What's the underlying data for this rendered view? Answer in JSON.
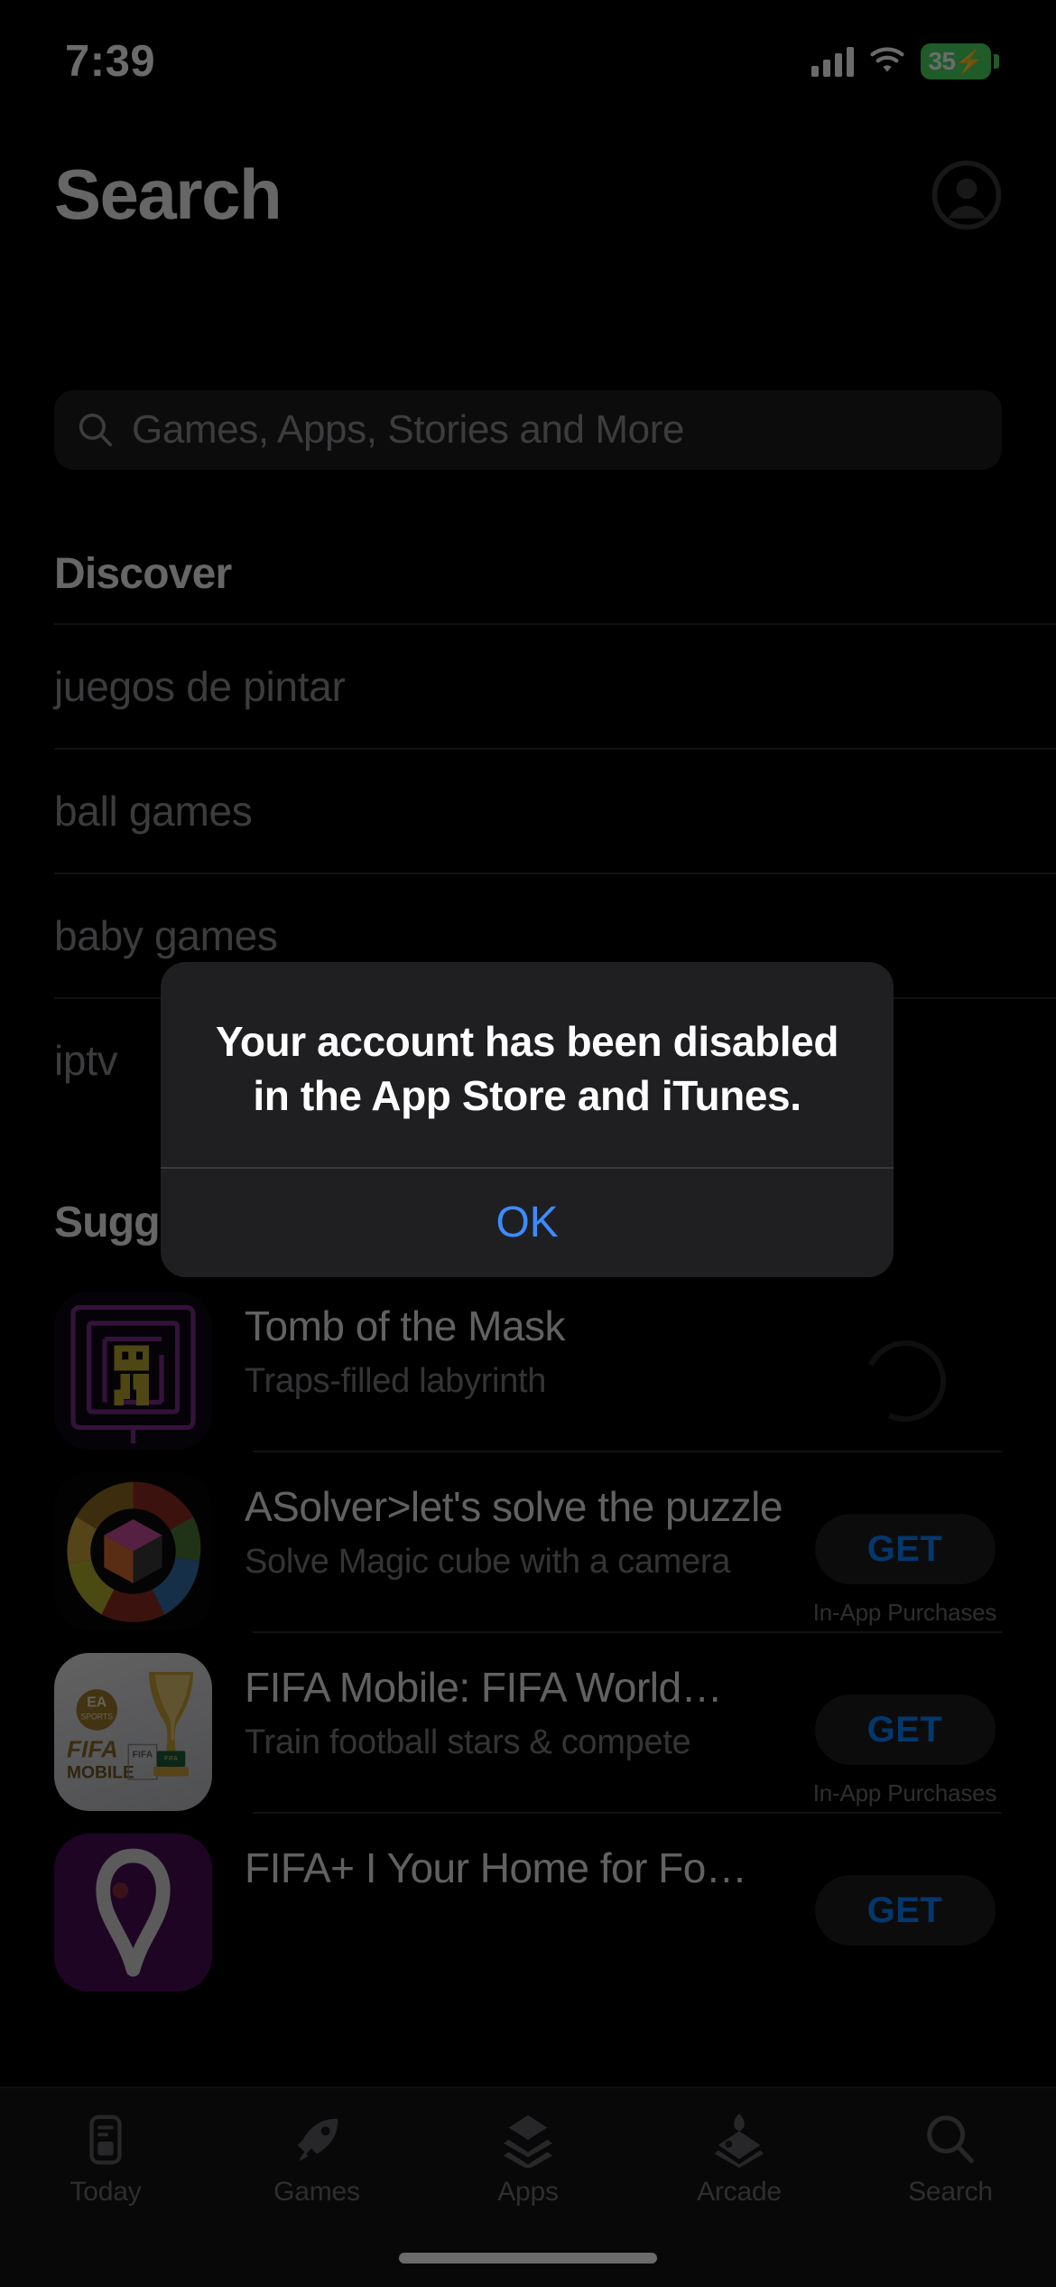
{
  "status_bar": {
    "time": "7:39",
    "cellular_icon": "cellular-bars-icon",
    "wifi_icon": "wifi-icon",
    "battery_percent": "35",
    "battery_charging_glyph": "⚡",
    "battery_color": "#4CD964"
  },
  "header": {
    "title": "Search",
    "account_icon": "account-avatar-icon"
  },
  "search": {
    "placeholder": "Games, Apps, Stories and More",
    "value": "",
    "icon": "search-icon"
  },
  "discover": {
    "title": "Discover",
    "items": [
      {
        "label": "juegos de pintar"
      },
      {
        "label": "ball games"
      },
      {
        "label": "baby games"
      },
      {
        "label": "iptv"
      }
    ]
  },
  "suggested": {
    "title": "Suggested",
    "apps": [
      {
        "name": "Tomb of the Mask",
        "subtitle": "Traps-filled labyrinth",
        "icon": "tomb-of-the-mask-icon",
        "action": "downloading",
        "action_label": "",
        "iap_label": ""
      },
      {
        "name": "ASolver>let's solve the puzzle",
        "subtitle": "Solve Magic cube with a camera",
        "icon": "asolver-icon",
        "action": "get",
        "action_label": "GET",
        "iap_label": "In-App Purchases"
      },
      {
        "name": "FIFA Mobile: FIFA World…",
        "subtitle": "Train football stars & compete",
        "icon": "fifa-mobile-icon",
        "action": "get",
        "action_label": "GET",
        "iap_label": "In-App Purchases"
      },
      {
        "name": "FIFA+ I Your Home for Fo…",
        "subtitle": "",
        "icon": "fifa-plus-icon",
        "action": "get",
        "action_label": "GET",
        "iap_label": ""
      }
    ]
  },
  "alert": {
    "message": "Your account has been disabled in the App Store and iTunes.",
    "ok_label": "OK",
    "ok_color": "#3d8bff"
  },
  "tab_bar": {
    "tabs": [
      {
        "label": "Today",
        "icon": "today-card-icon"
      },
      {
        "label": "Games",
        "icon": "rocket-icon"
      },
      {
        "label": "Apps",
        "icon": "stacked-squares-icon"
      },
      {
        "label": "Arcade",
        "icon": "joystick-icon"
      },
      {
        "label": "Search",
        "icon": "magnifier-icon"
      }
    ],
    "selected": "Search"
  },
  "home_indicator": "home-indicator-bar"
}
